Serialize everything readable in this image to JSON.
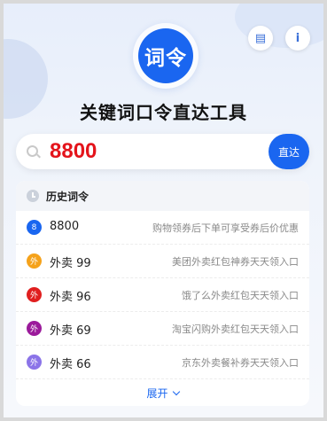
{
  "logo": {
    "text": "词令"
  },
  "header": {
    "title": "关键词口令直达工具"
  },
  "top_buttons": {
    "save_icon": "▤",
    "info_icon": "i"
  },
  "search": {
    "value": "8800",
    "placeholder": "",
    "go_label": "直达"
  },
  "history": {
    "title": "历史词令",
    "items": [
      {
        "badge": "8",
        "badge_color": "#1a66f0",
        "code": "8800",
        "desc": "购物领券后下单可享受券后价优惠"
      },
      {
        "badge": "外",
        "badge_color": "#f5a21b",
        "code": "外卖 99",
        "desc": "美团外卖红包神券天天领入口"
      },
      {
        "badge": "外",
        "badge_color": "#e01f1f",
        "code": "外卖 96",
        "desc": "饿了么外卖红包天天领入口"
      },
      {
        "badge": "外",
        "badge_color": "#9b1a9b",
        "code": "外卖 69",
        "desc": "淘宝闪购外卖红包天天领入口"
      },
      {
        "badge": "外",
        "badge_color": "#8b74e8",
        "code": "外卖 66",
        "desc": "京东外卖餐补券天天领入口"
      }
    ],
    "more_label": "展开"
  }
}
